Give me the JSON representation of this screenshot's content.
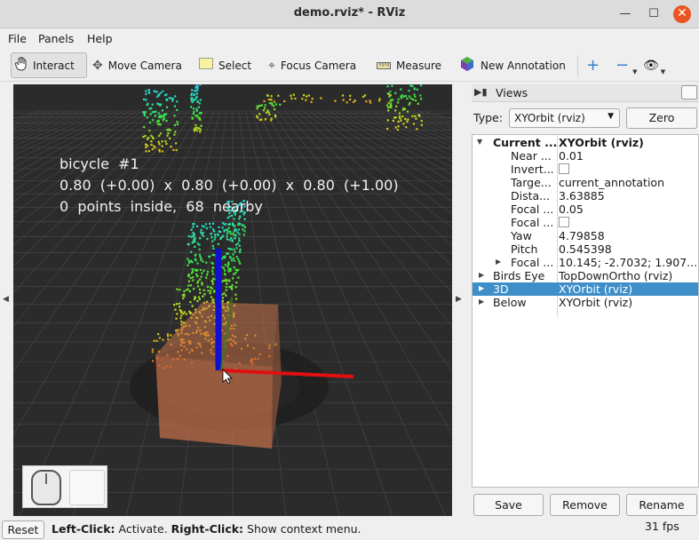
{
  "window": {
    "title": "demo.rviz* - RViz",
    "minimize_glyph": "—",
    "maximize_glyph": "☐",
    "close_glyph": "✕"
  },
  "menu": {
    "file": "File",
    "panels": "Panels",
    "help": "Help"
  },
  "toolbar": {
    "interact": "Interact",
    "move_camera": "Move Camera",
    "select": "Select",
    "focus_camera": "Focus Camera",
    "measure": "Measure",
    "new_annotation": "New  Annotation",
    "add_glyph": "+",
    "remove_glyph": "−",
    "eye_glyph": "👁"
  },
  "viewport": {
    "label_line1": "bicycle  #1",
    "label_line2": "0.80  (+0.00)  x  0.80  (+0.00)  x  0.80  (+1.00)",
    "label_line3": "0  points  inside,  68  nearby",
    "colors": {
      "background": "#2b2b2b",
      "grid": "#4a4a4a",
      "box": "#c8724a",
      "x_axis": "#e01010",
      "z_axis": "#1010d0"
    }
  },
  "views_panel": {
    "title": "Views",
    "type_label": "Type:",
    "type_value": "XYOrbit (rviz)",
    "zero_button": "Zero",
    "rows": [
      {
        "key": "Current ...",
        "value": "XYOrbit (rviz)"
      },
      {
        "key": "Near ...",
        "value": "0.01"
      },
      {
        "key": "Invert...",
        "value": ""
      },
      {
        "key": "Targe...",
        "value": "current_annotation"
      },
      {
        "key": "Dista...",
        "value": "3.63885"
      },
      {
        "key": "Focal ...",
        "value": "0.05"
      },
      {
        "key": "Focal ...",
        "value": ""
      },
      {
        "key": "Yaw",
        "value": "4.79858"
      },
      {
        "key": "Pitch",
        "value": "0.545398"
      },
      {
        "key": "Focal ...",
        "value": "10.145; -2.7032; 1.907..."
      },
      {
        "key": "Birds Eye",
        "value": "TopDownOrtho (rviz)"
      },
      {
        "key": "3D",
        "value": "XYOrbit (rviz)"
      },
      {
        "key": "Below",
        "value": "XYOrbit (rviz)"
      }
    ],
    "save_button": "Save",
    "remove_button": "Remove",
    "rename_button": "Rename",
    "selection_color": "#3d8ec9"
  },
  "status": {
    "reset_button": "Reset",
    "left_click_label": "Left-Click:",
    "left_click_text": " Activate. ",
    "right_click_label": "Right-Click:",
    "right_click_text": " Show context menu.",
    "fps": "31 fps"
  }
}
